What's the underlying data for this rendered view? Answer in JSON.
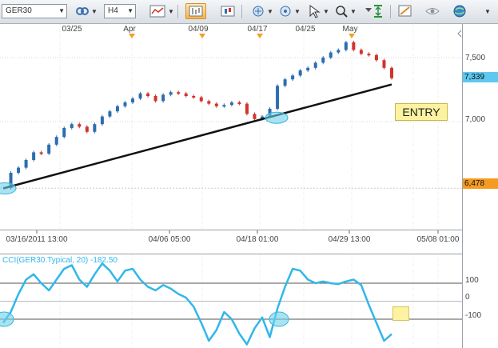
{
  "toolbar": {
    "symbol": "GER30",
    "timeframe": "H4",
    "icons": [
      "crosshair-link-icon",
      "indicator-icon",
      "bar-chart-icon",
      "candle-chart-icon",
      "pan-icon",
      "hand-icon",
      "arrow-cursor-icon",
      "zoom-icon",
      "marker-icon",
      "fit-icon",
      "draw-icon",
      "eye-icon",
      "globe-icon"
    ]
  },
  "top_dates": [
    "03/25",
    "Apr",
    "04/09",
    "04/17",
    "04/25",
    "May"
  ],
  "bottom_dates": [
    "03/16/2011 13:00",
    "04/06 05:00",
    "04/18 01:00",
    "04/29 13:00",
    "05/08 01:00"
  ],
  "price_axis": {
    "labels": [
      "7,500",
      "7,000"
    ],
    "current_price": "7,339",
    "level_price": "6,478",
    "current_color": "#5ec8f0",
    "level_color": "#f59a22"
  },
  "annotation": {
    "entry_label": "ENTRY"
  },
  "cci": {
    "title": "CCI(GER30.Typical, 20) -182.50",
    "levels": [
      "100",
      "0",
      "-100"
    ],
    "color": "#31b7e9"
  },
  "chart_data": [
    {
      "type": "candlestick",
      "symbol": "GER30",
      "timeframe": "H4",
      "x_range": [
        "03/16/2011 13:00",
        "05/08/2011 01:00"
      ],
      "ylim": [
        6200,
        7700
      ],
      "y_ticks": [
        7000,
        7500
      ],
      "series": [
        {
          "values": [
            6480,
            6600,
            6640,
            6700,
            6760,
            6750,
            6820,
            6880,
            6950,
            6980,
            6960,
            6920,
            6980,
            7040,
            7080,
            7120,
            7150,
            7180,
            7220,
            7200,
            7160,
            7210,
            7230,
            7220,
            7200,
            7190,
            7160,
            7140,
            7120,
            7130,
            7150,
            7140,
            7060,
            7020,
            7040,
            7100,
            7280,
            7330,
            7360,
            7400,
            7420,
            7460,
            7500,
            7540,
            7560,
            7620,
            7560,
            7530,
            7520,
            7480,
            7420,
            7339
          ]
        }
      ],
      "trendline": {
        "from": [
          "03/16/2011",
          6478
        ],
        "to": [
          "05/04/2011",
          7290
        ]
      },
      "highlight_points": [
        [
          "03/16/2011",
          6478
        ],
        [
          "04/18/2011",
          7030
        ]
      ],
      "current_price": 7339
    },
    {
      "type": "line",
      "title": "CCI(GER30.Typical, 20) -182.50",
      "ylim": [
        -260,
        260
      ],
      "levels": [
        100,
        0,
        -100
      ],
      "series": [
        {
          "values": [
            -120,
            -60,
            40,
            120,
            150,
            100,
            60,
            120,
            180,
            200,
            120,
            80,
            150,
            210,
            170,
            110,
            170,
            180,
            120,
            80,
            60,
            90,
            70,
            40,
            20,
            -30,
            -120,
            -220,
            -160,
            -60,
            -100,
            -180,
            -240,
            -150,
            -90,
            -200,
            -40,
            80,
            180,
            170,
            120,
            100,
            110,
            100,
            95,
            110,
            120,
            90,
            -20,
            -120,
            -220,
            -182.5
          ]
        }
      ],
      "highlight_points": [
        [
          0,
          -100
        ],
        [
          40,
          -100
        ]
      ]
    }
  ]
}
